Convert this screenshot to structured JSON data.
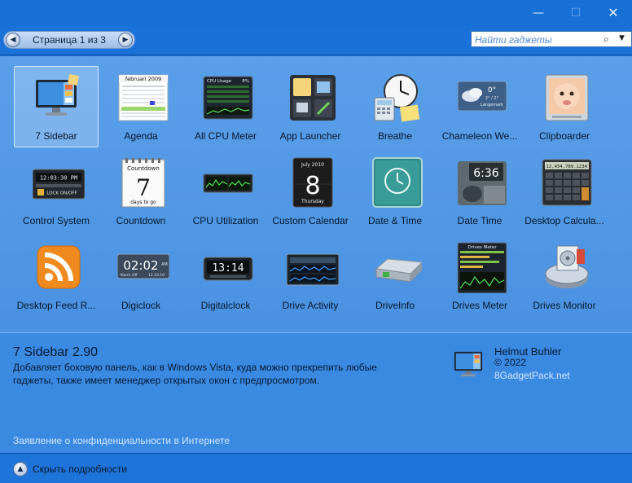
{
  "window": {
    "minimize_glyph": "—",
    "maximize_glyph": "☐",
    "close_glyph": "✕"
  },
  "nav": {
    "page_label": "Страница 1 из 3",
    "prev_glyph": "◀",
    "next_glyph": "▶"
  },
  "search": {
    "placeholder": "Найти гаджеты",
    "icon_glyph": "⌕",
    "dropdown_glyph": "▼"
  },
  "gadgets": [
    {
      "label": "7 Sidebar",
      "icon": "sidebar-icon",
      "selected": true
    },
    {
      "label": "Agenda",
      "icon": "agenda-calendar-icon"
    },
    {
      "label": "All CPU Meter",
      "icon": "cpu-meter-icon"
    },
    {
      "label": "App Launcher",
      "icon": "app-launcher-icon"
    },
    {
      "label": "Breathe",
      "icon": "breathe-clock-icon"
    },
    {
      "label": "Chameleon We...",
      "icon": "weather-icon"
    },
    {
      "label": "Clipboarder",
      "icon": "clipboarder-icon"
    },
    {
      "label": "Control System",
      "icon": "control-system-icon"
    },
    {
      "label": "Countdown",
      "icon": "countdown-icon"
    },
    {
      "label": "CPU Utilization",
      "icon": "cpu-utilization-icon"
    },
    {
      "label": "Custom Calendar",
      "icon": "custom-calendar-icon"
    },
    {
      "label": "Date & Time",
      "icon": "date-time-clock-icon"
    },
    {
      "label": "Date Time",
      "icon": "flip-clock-icon"
    },
    {
      "label": "Desktop Calcula...",
      "icon": "calculator-icon"
    },
    {
      "label": "Desktop Feed R...",
      "icon": "rss-feed-icon"
    },
    {
      "label": "Digiclock",
      "icon": "digiclock-icon"
    },
    {
      "label": "Digitalclock",
      "icon": "digitalclock-icon"
    },
    {
      "label": "Drive Activity",
      "icon": "drive-activity-icon"
    },
    {
      "label": "DriveInfo",
      "icon": "drive-info-icon"
    },
    {
      "label": "Drives Meter",
      "icon": "drives-meter-icon"
    },
    {
      "label": "Drives Monitor",
      "icon": "drives-monitor-icon"
    }
  ],
  "icon_text": {
    "agenda_month": "februari 2009",
    "cpu_title": "CPU Usage",
    "cpu_pct": "8%",
    "weather_temp": "0°",
    "weather_range": "2° / 2°",
    "weather_city": "Langemark",
    "control_time": "12:03:30 PM",
    "control_lock": "LOCK ON/OFF",
    "countdown_title": "Countdown",
    "countdown_days": "7",
    "countdown_caption": "days to go",
    "calendar_month": "July 2010",
    "calendar_day": "8",
    "calendar_weekday": "Thursday",
    "flip_time": "6:36",
    "calc_display": "12,454,789.1234",
    "digiclock_time": "02:02",
    "digiclock_ampm": "AM",
    "digiclock_alarm": "Alarm Off",
    "digiclock_date": "12.10.10",
    "digitalclock_time": "13:14",
    "drives_meter_title": "Drives Meter"
  },
  "details": {
    "title": "7 Sidebar 2.90",
    "description": "Добавляет боковую панель, как в Windows Vista, куда можно прекрепить любые гаджеты, также имеет менеджер открытых окон с предпросмотром.",
    "author": "Helmut Buhler",
    "copyright": "© 2022",
    "link": "8GadgetPack.net",
    "privacy_link": "Заявление о конфиденциальности в Интернете"
  },
  "footer": {
    "toggle_label": "Скрыть подробности",
    "toggle_glyph": "▲"
  },
  "colors": {
    "titlebar": "#1670d6",
    "gallery": "#5a9fe8",
    "details": "#3a8ae2",
    "link": "#cfe6ff"
  }
}
